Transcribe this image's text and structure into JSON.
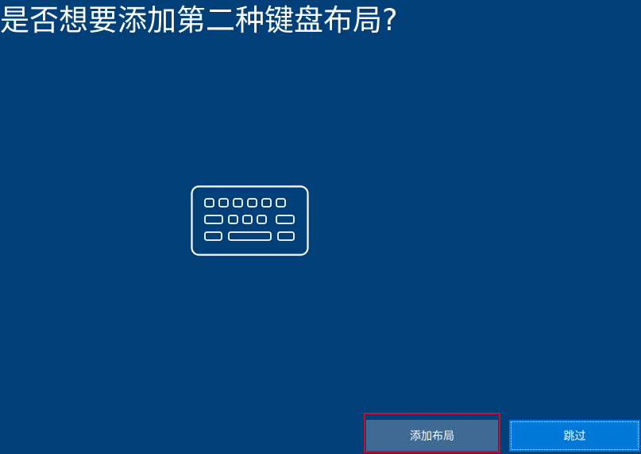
{
  "page": {
    "title": "是否想要添加第二种键盘布局?"
  },
  "icons": {
    "keyboard": "keyboard-icon"
  },
  "actions": {
    "add_layout_label": "添加布局",
    "skip_label": "跳过"
  },
  "colors": {
    "background": "#003f77",
    "primary_button": "#0078d7",
    "secondary_button": "#3e6a94",
    "highlight_border": "#c8102e"
  }
}
